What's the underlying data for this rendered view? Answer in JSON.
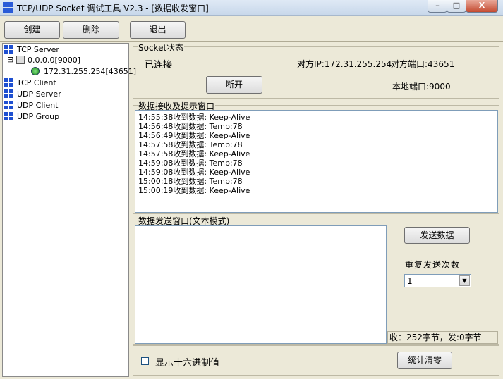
{
  "window": {
    "title": "TCP/UDP Socket 调试工具 V2.3 - [数据收发窗口]",
    "minimize_glyph": "–",
    "maximize_glyph": "□",
    "close_glyph": "X"
  },
  "toolbar": {
    "create_label": "创建",
    "delete_label": "删除",
    "exit_label": "退出"
  },
  "tree": {
    "tcp_server": "TCP Server",
    "server_node": "0.0.0.0[9000]",
    "client_node": "172.31.255.254[43651]",
    "tcp_client": "TCP Client",
    "udp_server": "UDP Server",
    "udp_client": "UDP Client",
    "udp_group": "UDP Group",
    "expander": "⊟"
  },
  "socket_status": {
    "group_label": "Socket状态",
    "state": "已连接",
    "peer_ip": "对方IP:172.31.255.254",
    "peer_port": "对方端口:43651",
    "local_port": "本地端口:9000",
    "disconnect_label": "断开"
  },
  "receive": {
    "group_label": "数据接收及提示窗口",
    "lines": [
      "14:55:38收到数据: Keep-Alive",
      "14:56:48收到数据: Temp:78",
      "14:56:49收到数据: Keep-Alive",
      "14:57:58收到数据: Temp:78",
      "14:57:58收到数据: Keep-Alive",
      "14:59:08收到数据: Temp:78",
      "14:59:08收到数据: Keep-Alive",
      "15:00:18收到数据: Temp:78",
      "15:00:19收到数据: Keep-Alive"
    ]
  },
  "send": {
    "group_label": "数据发送窗口(文本模式)",
    "text_value": "",
    "send_label": "发送数据",
    "repeat_label": "重复发送次数",
    "repeat_value": "1",
    "counter": "收：252字节，发:0字节"
  },
  "bottom": {
    "hex_label": "显示十六进制值",
    "hex_checked": false,
    "clear_label": "统计清零"
  },
  "colors": {
    "dialog_bg": "#ece9d8",
    "tree_icon_blue": "#1e4fd0",
    "close_red": "#c44a30"
  }
}
